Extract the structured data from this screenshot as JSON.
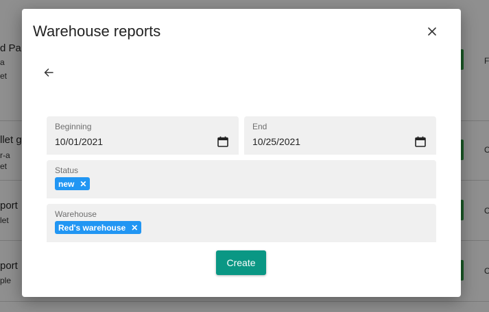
{
  "background": {
    "rows": [
      {
        "title": "d Pa",
        "sub1": "a",
        "sub2": "et",
        "right": "F"
      },
      {
        "title": "llet g",
        "sub1": "r-a",
        "sub2": "et",
        "right": "C"
      },
      {
        "title": "port",
        "sub1": "",
        "sub2": "let",
        "right": "C"
      },
      {
        "title": "port",
        "sub1": "",
        "sub2": "ple",
        "right": "C"
      }
    ]
  },
  "dialog": {
    "title": "Warehouse reports",
    "beginning": {
      "label": "Beginning",
      "value": "10/01/2021"
    },
    "end": {
      "label": "End",
      "value": "10/25/2021"
    },
    "status": {
      "label": "Status",
      "chip": "new"
    },
    "warehouse": {
      "label": "Warehouse",
      "chip": "Red's warehouse"
    },
    "create_label": "Create",
    "chip_remove": "✕"
  },
  "colors": {
    "chip": "#2196f3",
    "create_button": "#0a9784",
    "accent_green": "#2f9e44"
  },
  "icons": {
    "back": "arrow-left-icon",
    "close": "close-icon",
    "calendar": "calendar-icon"
  }
}
